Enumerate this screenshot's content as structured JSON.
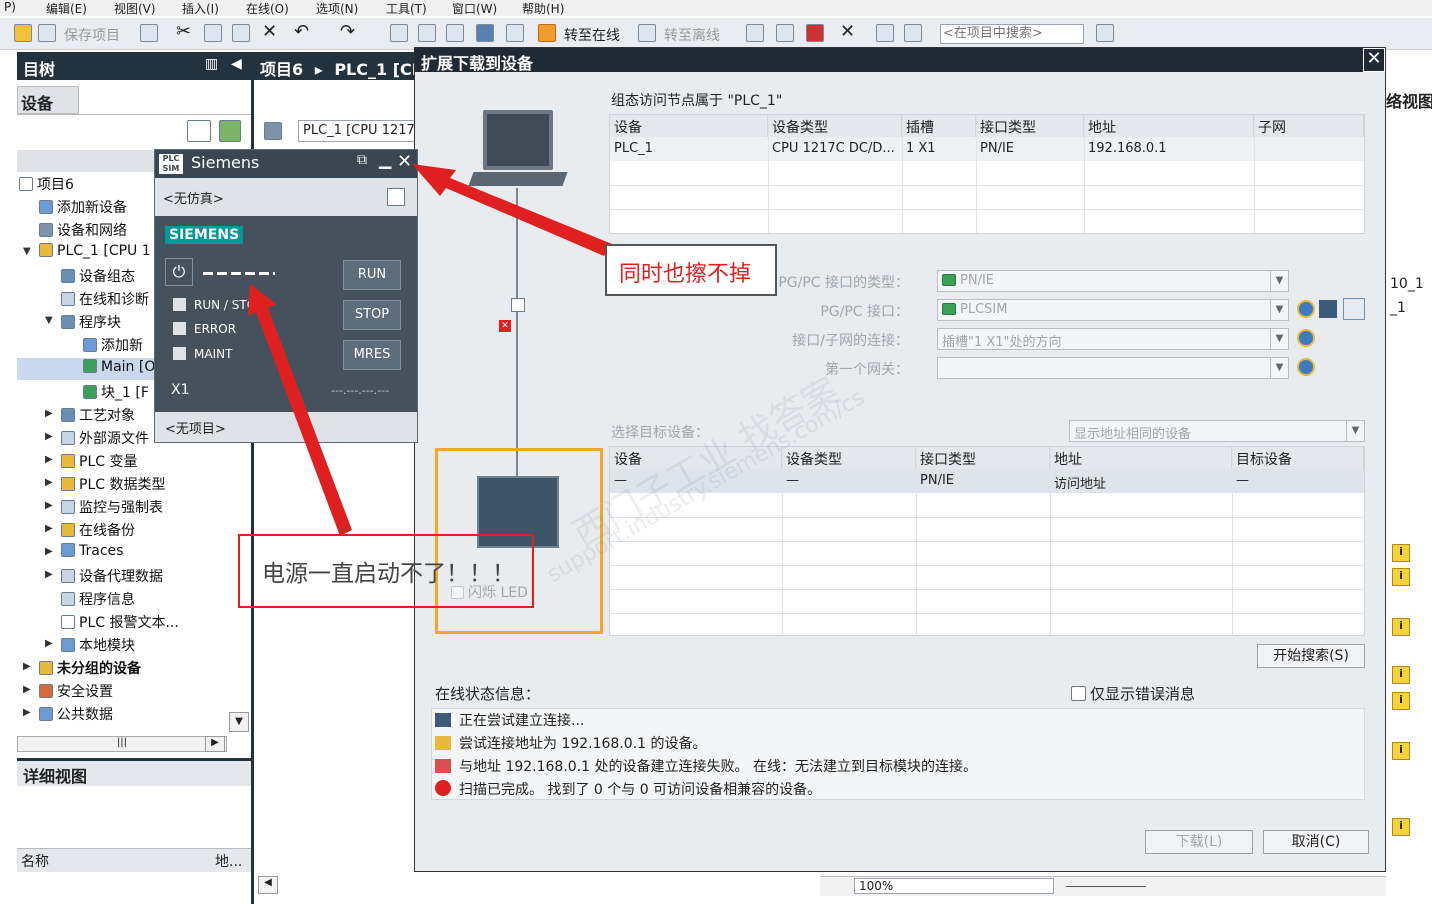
{
  "menu": {
    "items": [
      "P)",
      "编辑(E)",
      "视图(V)",
      "插入(I)",
      "在线(O)",
      "选项(N)",
      "工具(T)",
      "窗口(W)",
      "帮助(H)"
    ]
  },
  "toolbar": {
    "save_label": "保存项目",
    "go_online": "转至在线",
    "go_offline": "转至离线",
    "search_placeholder": "<在项目中搜索>"
  },
  "tree": {
    "pane_title": "目树",
    "devices_tab": "设备",
    "items": [
      "项目6",
      "添加新设备",
      "设备和网络",
      "PLC_1 [CPU 1",
      "设备组态",
      "在线和诊断",
      "程序块",
      "添加新",
      "Main [O",
      "块_1 [F",
      "工艺对象",
      "外部源文件",
      "PLC 变量",
      "PLC 数据类型",
      "监控与强制表",
      "在线备份",
      "Traces",
      "设备代理数据",
      "程序信息",
      "PLC 报警文本...",
      "本地模块",
      "未分组的设备",
      "安全设置",
      "公共数据"
    ],
    "details_title": "详细视图",
    "col_name": "名称",
    "col_addr": "地..."
  },
  "editor": {
    "breadcrumb_project": "项目6",
    "breadcrumb_plc": "PLC_1 [CP",
    "device_field": "PLC_1 [CPU 1217"
  },
  "plcsim": {
    "title": "Siemens",
    "no_sim": "<无仿真>",
    "brand": "SIEMENS",
    "leds": [
      "RUN / STOP",
      "ERROR",
      "MAINT"
    ],
    "buttons": [
      "RUN",
      "STOP",
      "MRES"
    ],
    "port": "X1",
    "ip": "---.---.---.---",
    "no_project": "<无项目>"
  },
  "dialog": {
    "title": "扩展下载到设备",
    "config_header": "组态访问节点属于 \"PLC_1\"",
    "config_cols": [
      "设备",
      "设备类型",
      "插槽",
      "接口类型",
      "地址",
      "子网"
    ],
    "config_row": [
      "PLC_1",
      "CPU 1217C DC/D...",
      "1 X1",
      "PN/IE",
      "192.168.0.1",
      ""
    ],
    "pgpc_type_label": "PG/PC 接口的类型：",
    "pgpc_type_value": "PN/IE",
    "pgpc_if_label": "PG/PC 接口：",
    "pgpc_if_value": "PLCSIM",
    "conn_label": "接口/子网的连接：",
    "conn_value": "插槽\"1 X1\"处的方向",
    "gateway_label": "第一个网关：",
    "gateway_value": "",
    "target_header": "选择目标设备：",
    "target_filter": "显示地址相同的设备",
    "target_cols": [
      "设备",
      "设备类型",
      "接口类型",
      "地址",
      "目标设备"
    ],
    "target_row": [
      "—",
      "—",
      "PN/IE",
      "访问地址",
      "—"
    ],
    "flash_led": "闪烁 LED",
    "search_button": "开始搜索(S)",
    "status_header": "在线状态信息：",
    "errors_only": "仅显示错误消息",
    "messages": [
      "正在尝试建立连接...",
      "尝试连接地址为 192.168.0.1 的设备。",
      "与地址 192.168.0.1 处的设备建立连接失败。 在线：无法建立到目标模块的连接。",
      "扫描已完成。 找到了 0 个与 0 可访问设备相兼容的设备。"
    ],
    "download_button": "下载(L)",
    "cancel_button": "取消(C)"
  },
  "right_panel": {
    "title": "络视图",
    "item1": "10_1",
    "item2": "_1"
  },
  "bottom": {
    "zoom": "100%"
  },
  "annotations": {
    "callout_top": "同时也擦不掉",
    "callout_bottom": "电源一直启动不了！！！"
  },
  "watermark": {
    "line1": "西门子工业 找答案",
    "line2": "support.industry.siemens.com/cs"
  },
  "colors": {
    "title_bar": "#1e2b36",
    "plcsim_body": "#45525e",
    "siemens_brand": "#009999",
    "callout_red": "#e02020",
    "target_highlight": "#f5a623"
  }
}
